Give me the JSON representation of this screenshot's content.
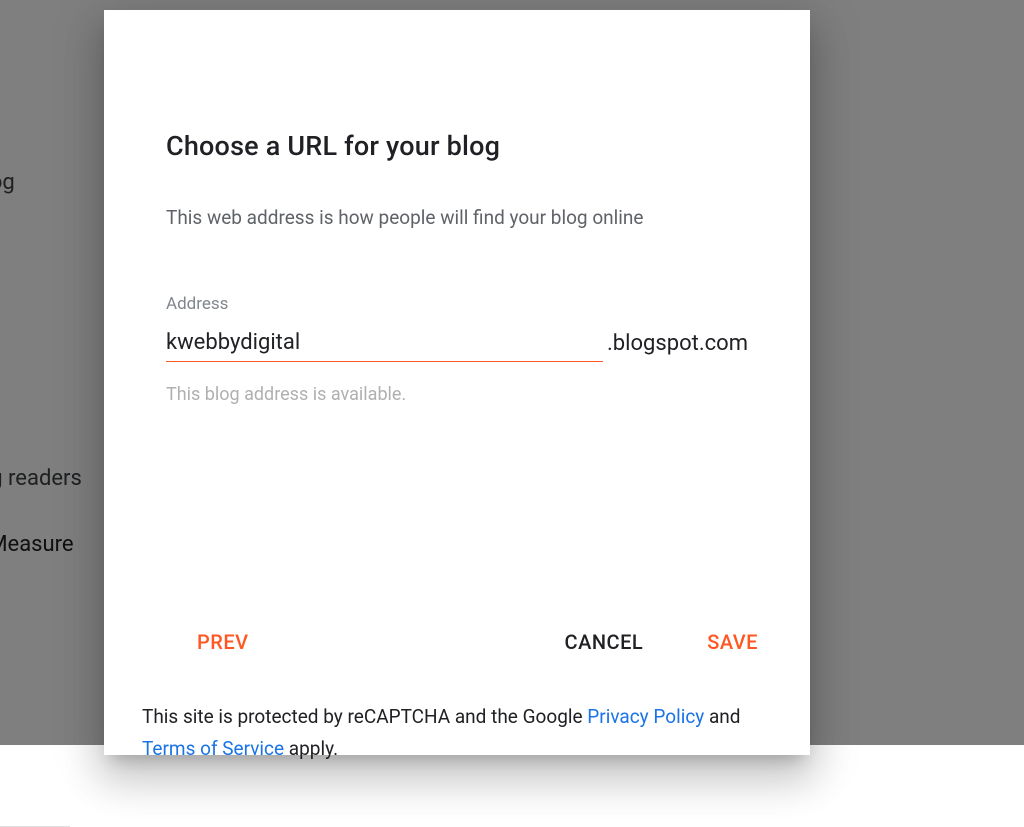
{
  "backdrop": {
    "text1": "l Blog",
    "text2": "blog readers",
    "text3": "cs Measure"
  },
  "dialog": {
    "title": "Choose a URL for your blog",
    "subtitle": "This web address is how people will find your blog online",
    "field_label": "Address",
    "address_value": "kwebbydigital",
    "domain_suffix": ".blogspot.com",
    "availability_message": "This blog address is available.",
    "buttons": {
      "prev": "PREV",
      "cancel": "CANCEL",
      "save": "SAVE"
    },
    "recaptcha": {
      "prefix": "This site is protected by reCAPTCHA and the Google ",
      "privacy_link_text": "Privacy Policy",
      "middle": " and ",
      "terms_link_text": "Terms of Service",
      "suffix": " apply."
    }
  }
}
